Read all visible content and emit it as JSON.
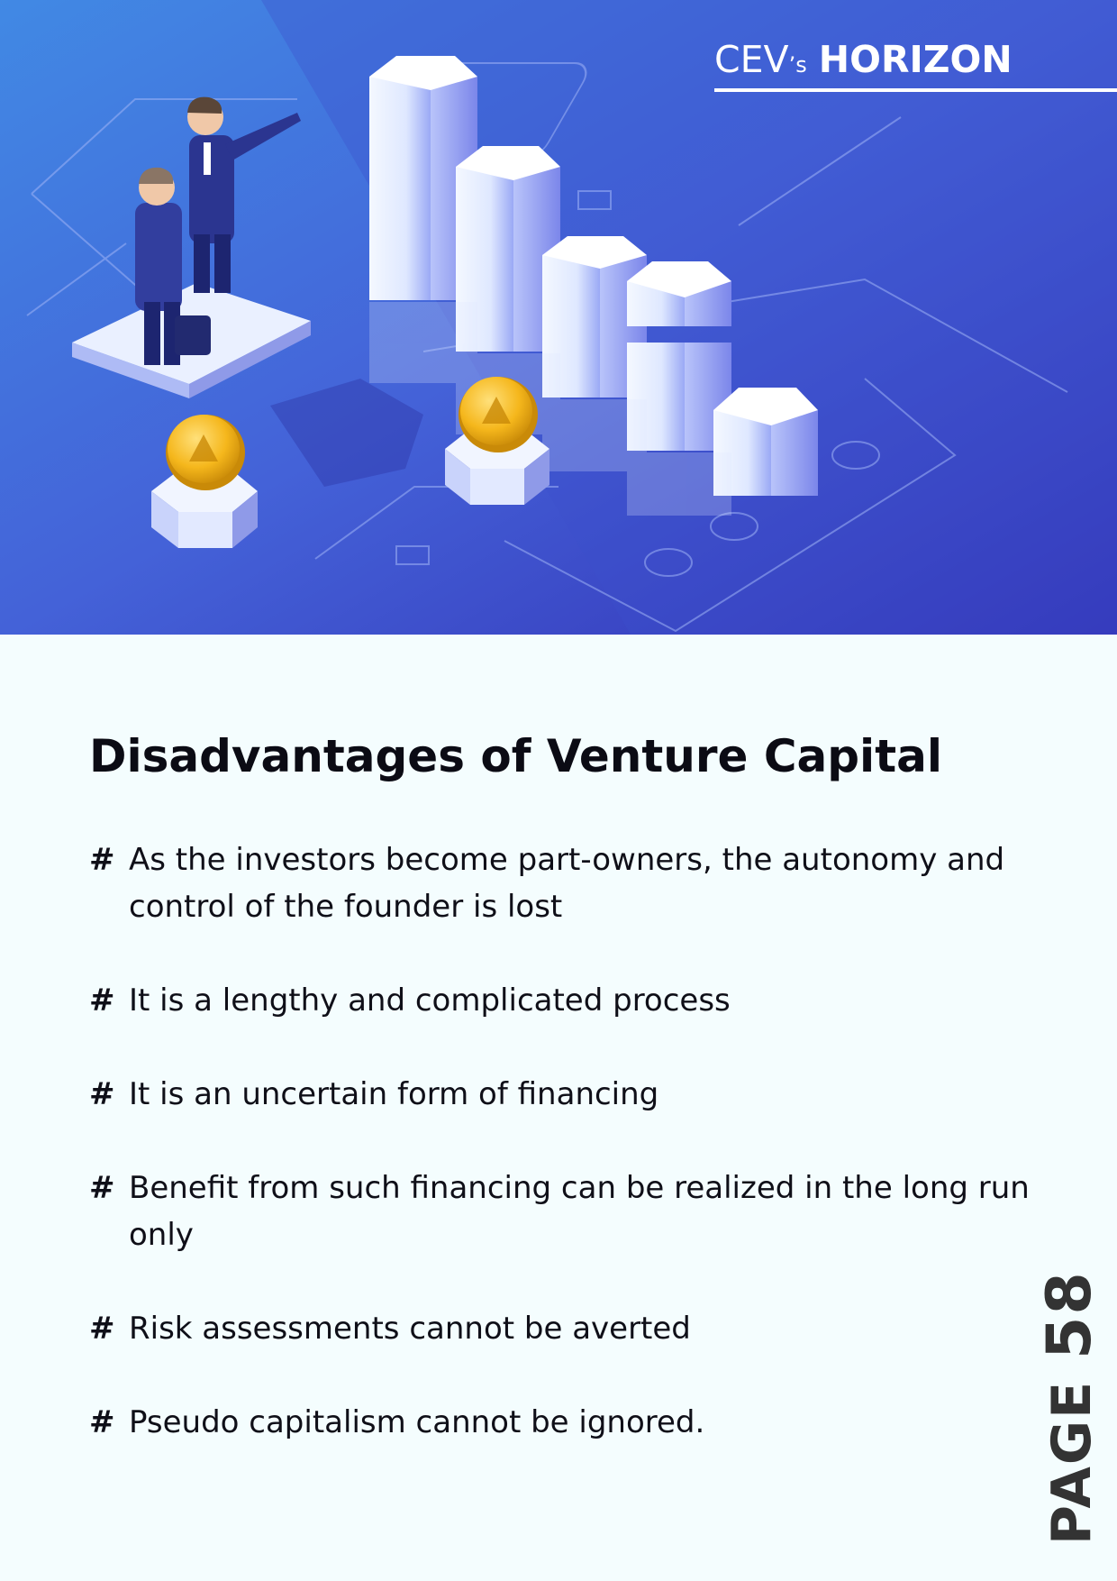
{
  "brand": {
    "prefix": "CEV",
    "suffix": "’s",
    "name": "HORIZON"
  },
  "colors": {
    "hero_start": "#3f7fe0",
    "hero_end": "#3333b8",
    "coin": "#f5b71c",
    "background": "#f4fdfe",
    "text": "#0f0f18"
  },
  "article": {
    "title": "Disadvantages of Venture Capital",
    "bullet_marker": "#",
    "bullets": [
      "As the investors become part-owners, the autonomy and control of the founder is lost",
      "It is a lengthy and complicated process",
      "It is an uncertain form of financing",
      "Benefit from such financing can be realized in the long run only",
      "Risk assessments cannot be averted",
      "Pseudo capitalism cannot be ignored."
    ]
  },
  "page": {
    "label": "PAGE",
    "number": "58"
  }
}
